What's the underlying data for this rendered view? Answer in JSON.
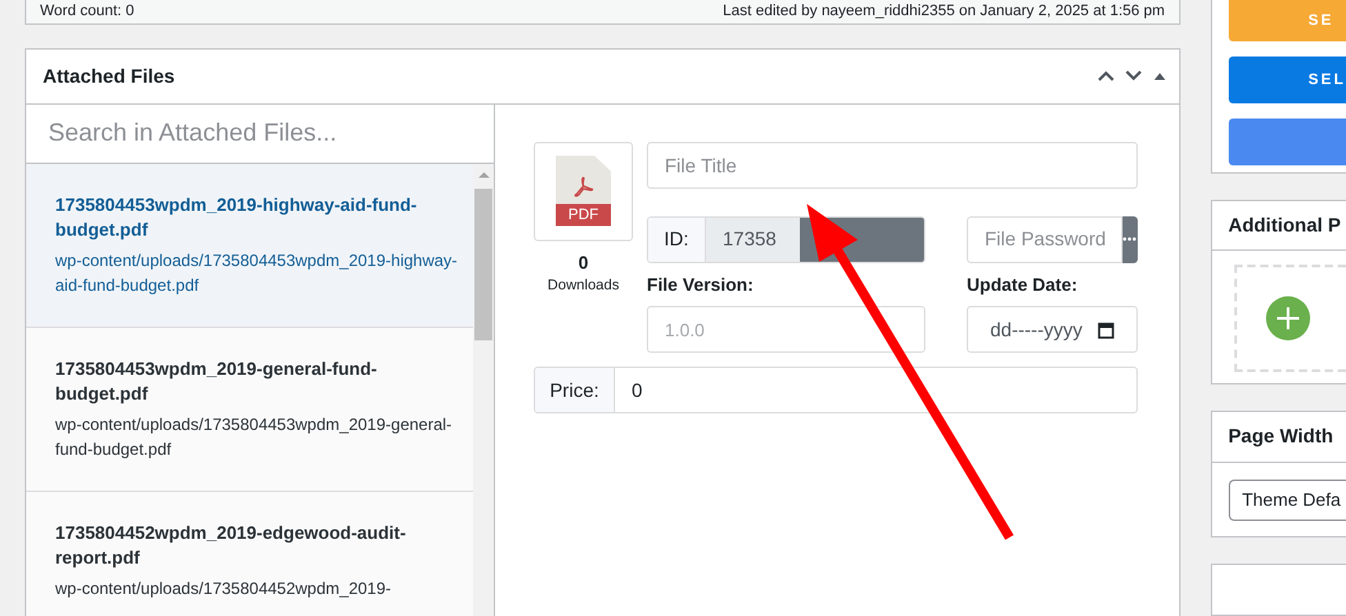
{
  "status_bar": {
    "word_count": "Word count: 0",
    "last_edited": "Last edited by nayeem_riddhi2355 on January 2, 2025 at 1:56 pm"
  },
  "attached_files": {
    "title": "Attached Files",
    "search": {
      "placeholder": "Search in Attached Files..."
    },
    "files": [
      {
        "name": "1735804453wpdm_2019-highway-aid-fund-budget.pdf",
        "path": "wp-content/uploads/1735804453wpdm_2019-highway-aid-fund-budget.pdf",
        "selected": true
      },
      {
        "name": "1735804453wpdm_2019-general-fund-budget.pdf",
        "path": "wp-content/uploads/1735804453wpdm_2019-general-fund-budget.pdf",
        "selected": false
      },
      {
        "name": "1735804452wpdm_2019-edgewood-audit-report.pdf",
        "path": "wp-content/uploads/1735804452wpdm_2019-",
        "selected": false
      }
    ],
    "details": {
      "file_type": "PDF",
      "downloads_count": "0",
      "downloads_label": "Downloads",
      "title": {
        "placeholder": "File Title"
      },
      "id_label": "ID:",
      "id_value": "17358",
      "password": {
        "placeholder": "File Password"
      },
      "version_label": "File Version:",
      "version": {
        "placeholder": "1.0.0"
      },
      "update_date_label": "Update Date:",
      "update_date": {
        "placeholder": "dd-----yyyy"
      },
      "price_label": "Price:",
      "price": "0"
    }
  },
  "sidebar": {
    "buttons": [
      {
        "label": "SE",
        "color": "#f6a935"
      },
      {
        "label": "SEL",
        "color": "#0a7ae3"
      },
      {
        "color": "#4a8af0"
      }
    ],
    "additional_panel": {
      "title": "Additional P"
    },
    "page_width_panel": {
      "title": "Page Width",
      "select_value": "Theme Defa"
    }
  }
}
